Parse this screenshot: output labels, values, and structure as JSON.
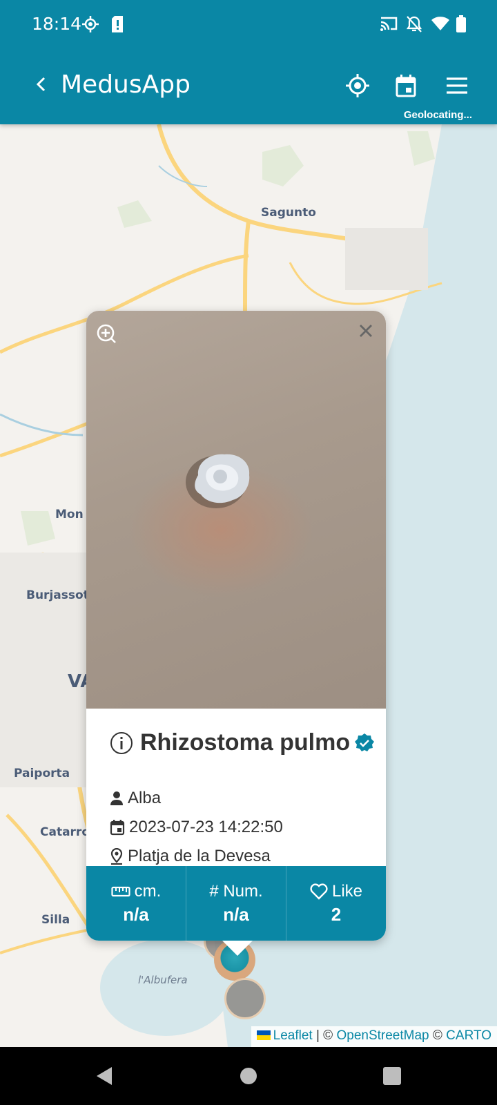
{
  "status_bar": {
    "time": "18:14"
  },
  "app_bar": {
    "title": "MedusApp",
    "geolocating": "Geolocating..."
  },
  "map": {
    "places": [
      "Sagunto",
      "Mon",
      "Burjassot",
      "VA",
      "Paiporta",
      "Catarro",
      "Silla",
      "l'Albufera"
    ],
    "attribution": {
      "leaflet": "Leaflet",
      "sep1": " | © ",
      "osm": "OpenStreetMap",
      "sep2": " © ",
      "carto": "CARTO"
    }
  },
  "popup": {
    "species": "Rhizostoma pulmo",
    "user": "Alba",
    "datetime": "2023-07-23 14:22:50",
    "location": "Platja de la Devesa",
    "stats": [
      {
        "label": "cm.",
        "value": "n/a"
      },
      {
        "label": "# Num.",
        "value": "n/a"
      },
      {
        "label": "Like",
        "value": "2"
      }
    ]
  },
  "colors": {
    "primary": "#0a87a5",
    "sea": "#d5e7eb",
    "land": "#f4f2ee",
    "roads": "#fbd57e"
  }
}
